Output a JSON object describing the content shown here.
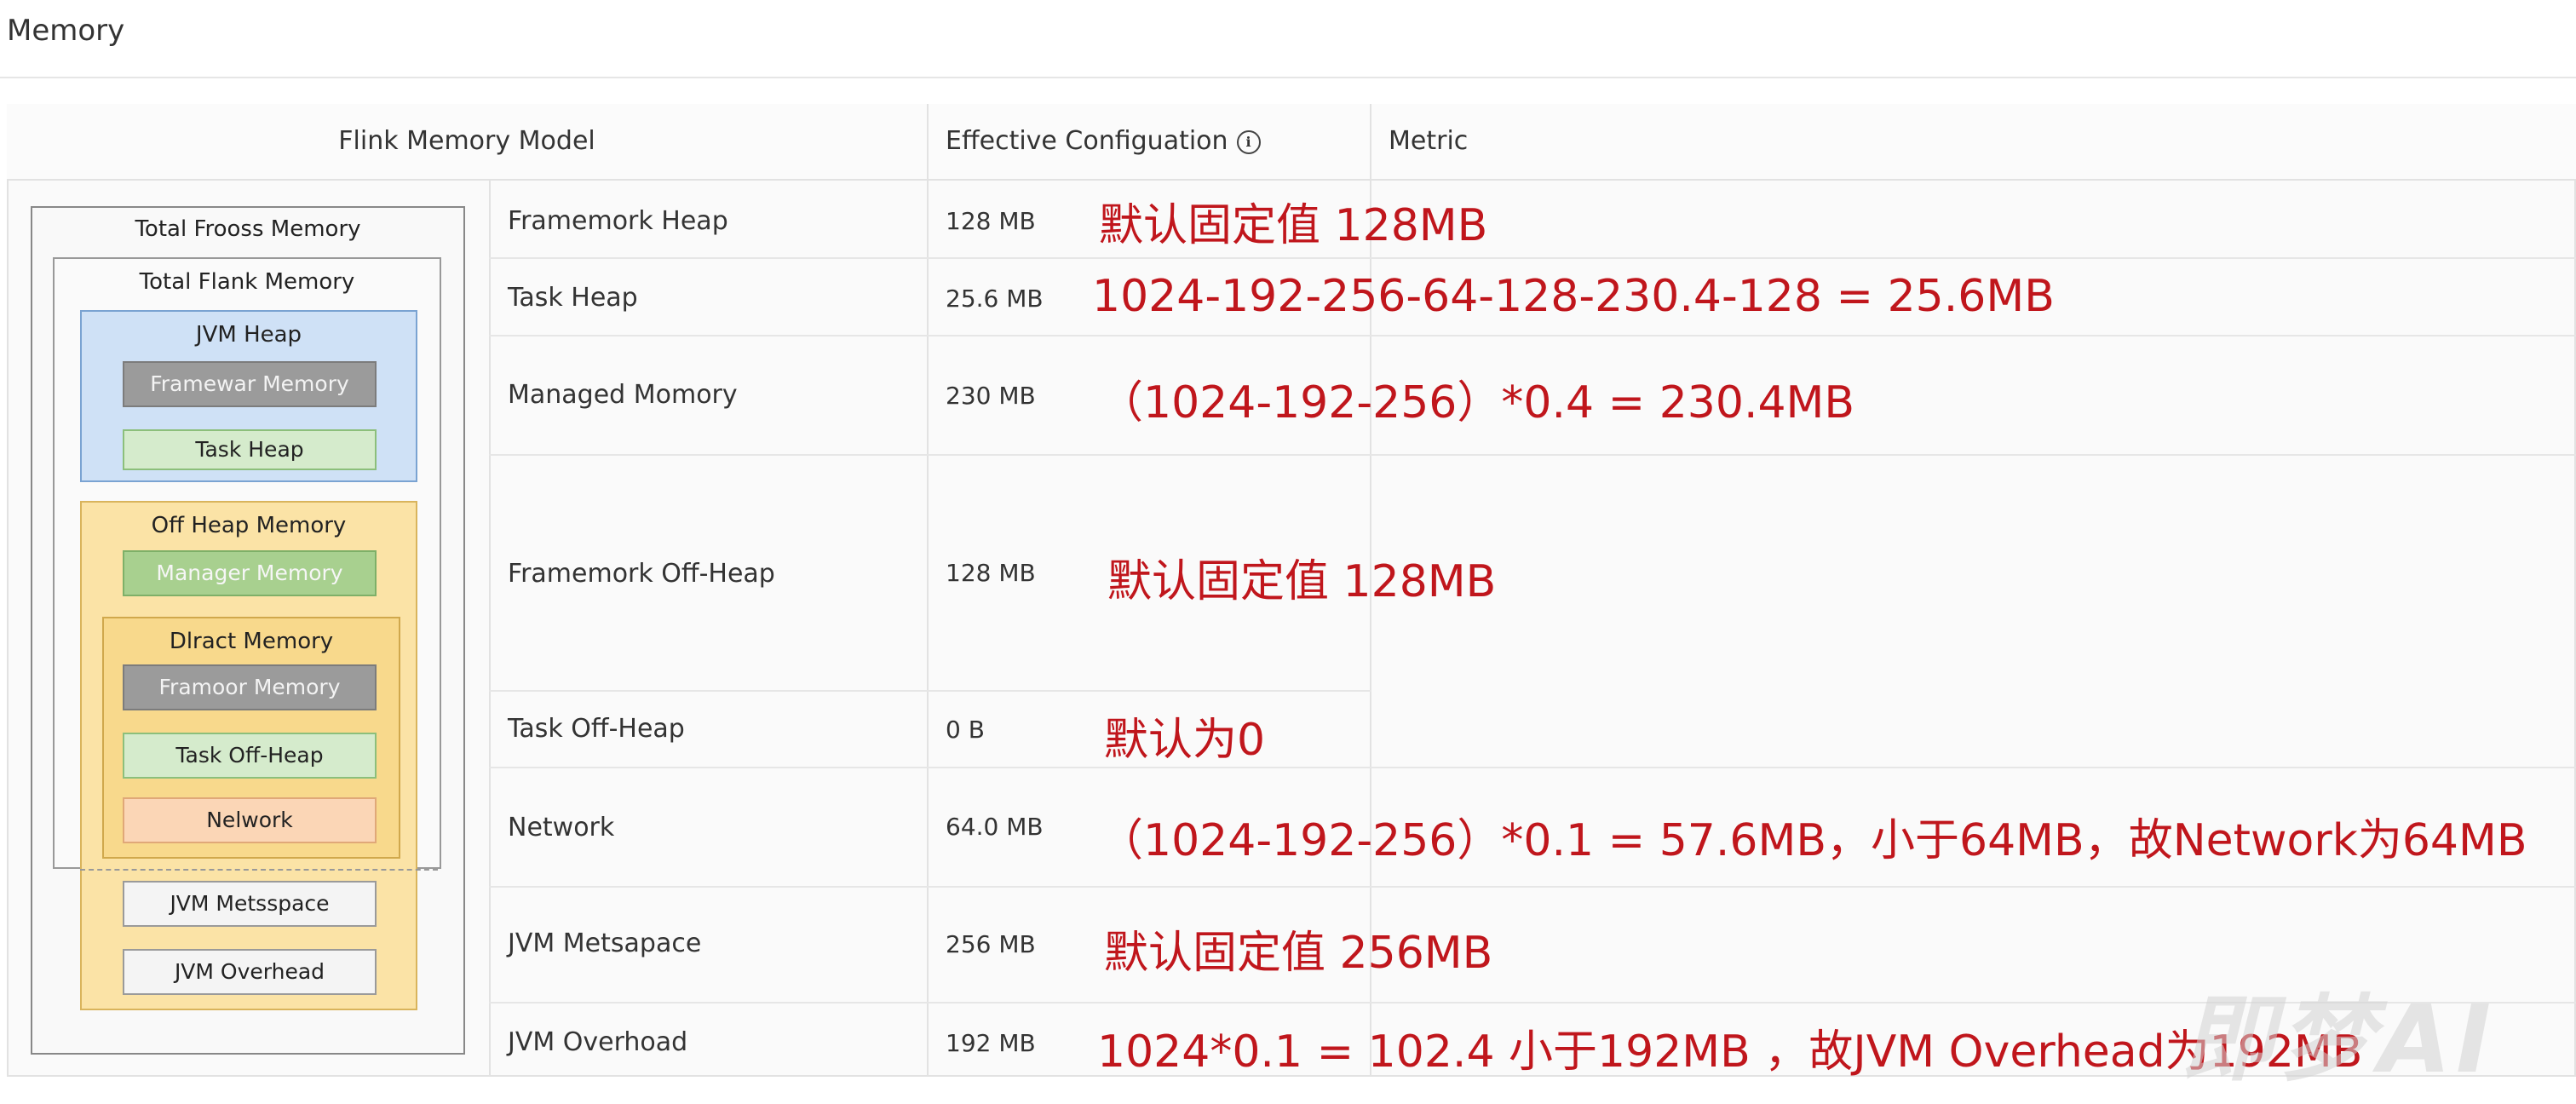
{
  "page": {
    "title": "Memory"
  },
  "table": {
    "headers": {
      "model": "Flink Memory Model",
      "config": "Effective Configuation",
      "config_icon": "info-icon",
      "metric": "Metric"
    },
    "rows": [
      {
        "name": "Framemork Heap",
        "value": "128 MB",
        "annotation": "默认固定值 128MB"
      },
      {
        "name": "Task Heap",
        "value": "25.6 MB",
        "annotation": "1024-192-256-64-128-230.4-128 = 25.6MB"
      },
      {
        "name": "Managed Momory",
        "value": "230 MB",
        "annotation": "（1024-192-256）*0.4 = 230.4MB"
      },
      {
        "name": "Framemork Off-Heap",
        "value": "128 MB",
        "annotation": "默认固定值 128MB"
      },
      {
        "name": "Task Off-Heap",
        "value": "0 B",
        "annotation": "默认为0"
      },
      {
        "name": "Network",
        "value": "64.0 MB",
        "annotation": "（1024-192-256）*0.1 = 57.6MB，小于64MB，故Network为64MB"
      },
      {
        "name": "JVM Metsapace",
        "value": "256 MB",
        "annotation": "默认固定值 256MB"
      },
      {
        "name": "JVM Overhoad",
        "value": "192 MB",
        "annotation": "1024*0.1 = 102.4 小于192MB ，故JVM Overhead为192MB"
      }
    ]
  },
  "diagram": {
    "total_process": "Total Frooss Memory",
    "total_flink": "Total Flank Memory",
    "jvm_heap": "JVM Heap",
    "framework_heap": "Framewar Memory",
    "task_heap": "Task Heap",
    "off_heap": "Off Heap Memory",
    "managed": "Manager Memory",
    "direct": "Dlract Memory",
    "framework_off_heap": "Framoor Memory",
    "task_off_heap": "Task Off-Heap",
    "network": "Nelwork",
    "metaspace": "JVM Metsspace",
    "overhead": "JVM Overhead"
  },
  "watermark": {
    "text": "即梦AI"
  },
  "colors": {
    "annotation": "#c0161c",
    "jvm_heap": "#cfe1f6",
    "off_heap": "#fbe3a6",
    "gray_block": "#9b9b9b",
    "green_block": "#a8d08f",
    "light_green_block": "#d5ebcc",
    "peach_block": "#fbd6b6"
  }
}
